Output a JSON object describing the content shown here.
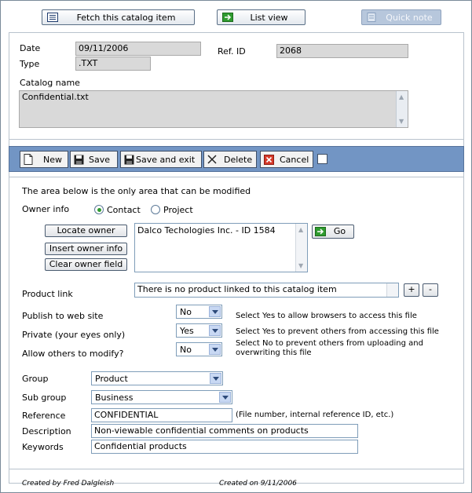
{
  "topbar": {
    "fetch_label": "Fetch this catalog item",
    "list_label": "List view",
    "quicknote_label": "Quick note"
  },
  "header": {
    "date_label": "Date",
    "date_value": "09/11/2006",
    "type_label": "Type",
    "type_value": ".TXT",
    "refid_label": "Ref. ID",
    "refid_value": "2068",
    "catalog_name_label": "Catalog name",
    "catalog_name_value": "Confidential.txt"
  },
  "toolbar": {
    "new_label": "New",
    "save_label": "Save",
    "save_exit_label": "Save and exit",
    "delete_label": "Delete",
    "cancel_label": "Cancel"
  },
  "form": {
    "notice": "The area below is the only area that can be modified",
    "owner_info_label": "Owner info",
    "owner_options": [
      "Contact",
      "Project"
    ],
    "owner_selected": "Contact",
    "locate_owner_label": "Locate owner",
    "insert_owner_label": "Insert owner info",
    "clear_owner_label": "Clear owner field",
    "owner_value": "Dalco Techologies Inc. - ID 1584",
    "go_label": "Go",
    "product_link_label": "Product link",
    "product_link_value": "There is no product linked to this catalog item",
    "plus_label": "+",
    "minus_label": "-",
    "publish_label": "Publish to web site",
    "publish_value": "No",
    "publish_hint": "Select Yes to allow browsers to access this file",
    "private_label": "Private (your eyes only)",
    "private_value": "Yes",
    "private_hint": "Select Yes to prevent others from accessing this file",
    "modify_label": "Allow others to modify?",
    "modify_value": "No",
    "modify_hint": "Select No to prevent others from uploading and overwriting this file",
    "group_label": "Group",
    "group_value": "Product",
    "subgroup_label": "Sub group",
    "subgroup_value": "Business",
    "reference_label": "Reference",
    "reference_value": "CONFIDENTIAL",
    "reference_hint": "(File number, internal reference ID, etc.)",
    "description_label": "Description",
    "description_value": "Non-viewable confidential comments on products",
    "keywords_label": "Keywords",
    "keywords_value": "Confidential products"
  },
  "footer": {
    "created_by": "Created by Fred Dalgleish",
    "created_on": "Created on 9/11/2006"
  },
  "colors": {
    "toolbar_bg": "#7295c4",
    "readonly_bg": "#d9d9d9",
    "quicknote_bg": "#b7c7dc"
  },
  "icons": {
    "fetch": "list-icon",
    "list": "arrow-right-icon",
    "quicknote": "note-icon",
    "new": "new-document-icon",
    "save": "floppy-icon",
    "save_exit": "floppy-icon",
    "delete": "x-icon",
    "cancel": "cancel-icon",
    "go": "arrow-right-icon"
  }
}
